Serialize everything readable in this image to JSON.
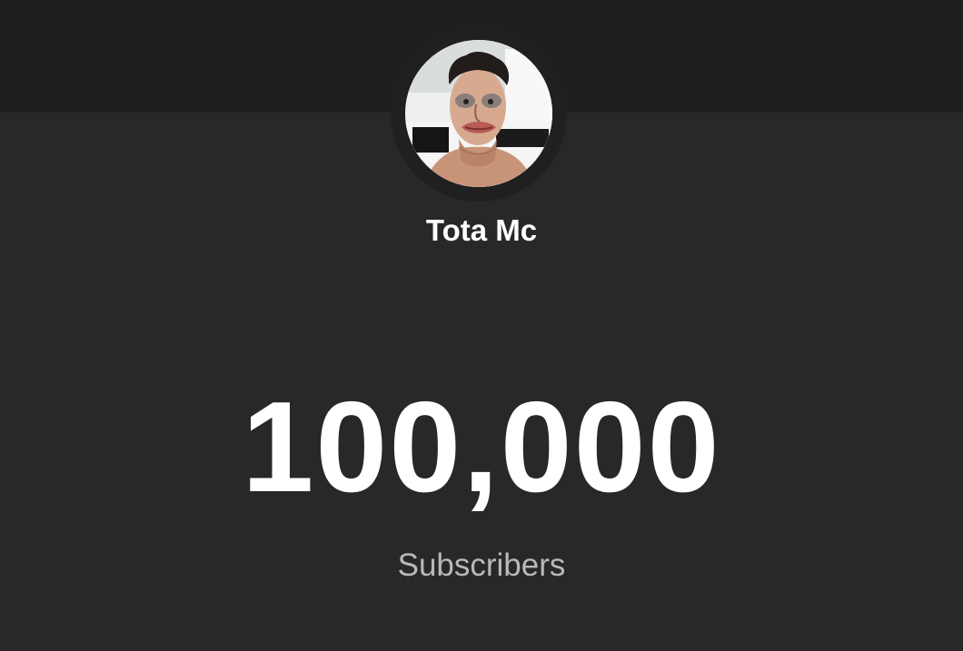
{
  "channel": {
    "name": "Tota Mc",
    "avatar_icon": "avatar-photo"
  },
  "stats": {
    "subscriber_count": "100,000",
    "subscriber_label": "Subscribers"
  },
  "colors": {
    "background": "#282828",
    "header_background": "#1f1f1f",
    "primary_text": "#ffffff",
    "secondary_text": "#b9b9b9"
  }
}
